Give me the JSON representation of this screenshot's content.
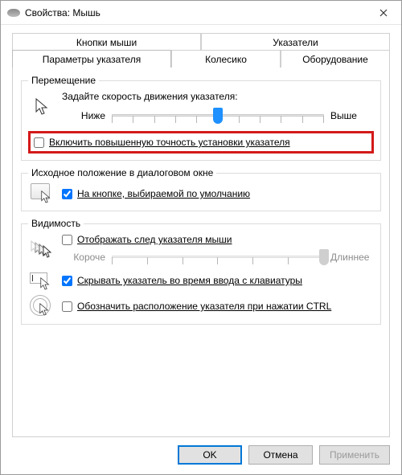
{
  "window": {
    "title": "Свойства: Мышь"
  },
  "tabs": {
    "row1": [
      "Кнопки мыши",
      "Указатели"
    ],
    "row2": [
      "Параметры указателя",
      "Колесико",
      "Оборудование"
    ],
    "active": "Параметры указателя"
  },
  "motion": {
    "legend": "Перемещение",
    "prompt": "Задайте скорость движения указателя:",
    "slow": "Ниже",
    "fast": "Выше",
    "ticks": 11,
    "value_index": 5,
    "enhance_label": "Включить повышенную точность установки указателя",
    "enhance_checked": false
  },
  "snap": {
    "legend": "Исходное положение в диалоговом окне",
    "label": "На кнопке, выбираемой по умолчанию",
    "checked": true
  },
  "visibility": {
    "legend": "Видимость",
    "trails_label": "Отображать след указателя мыши",
    "trails_checked": false,
    "trails_short": "Короче",
    "trails_long": "Длиннее",
    "trails_ticks": 7,
    "trails_value_index": 6,
    "hide_label": "Скрывать указатель во время ввода с клавиатуры",
    "hide_checked": true,
    "sonar_label": "Обозначить расположение указателя при нажатии CTRL",
    "sonar_checked": false
  },
  "buttons": {
    "ok": "OK",
    "cancel": "Отмена",
    "apply": "Применить"
  }
}
